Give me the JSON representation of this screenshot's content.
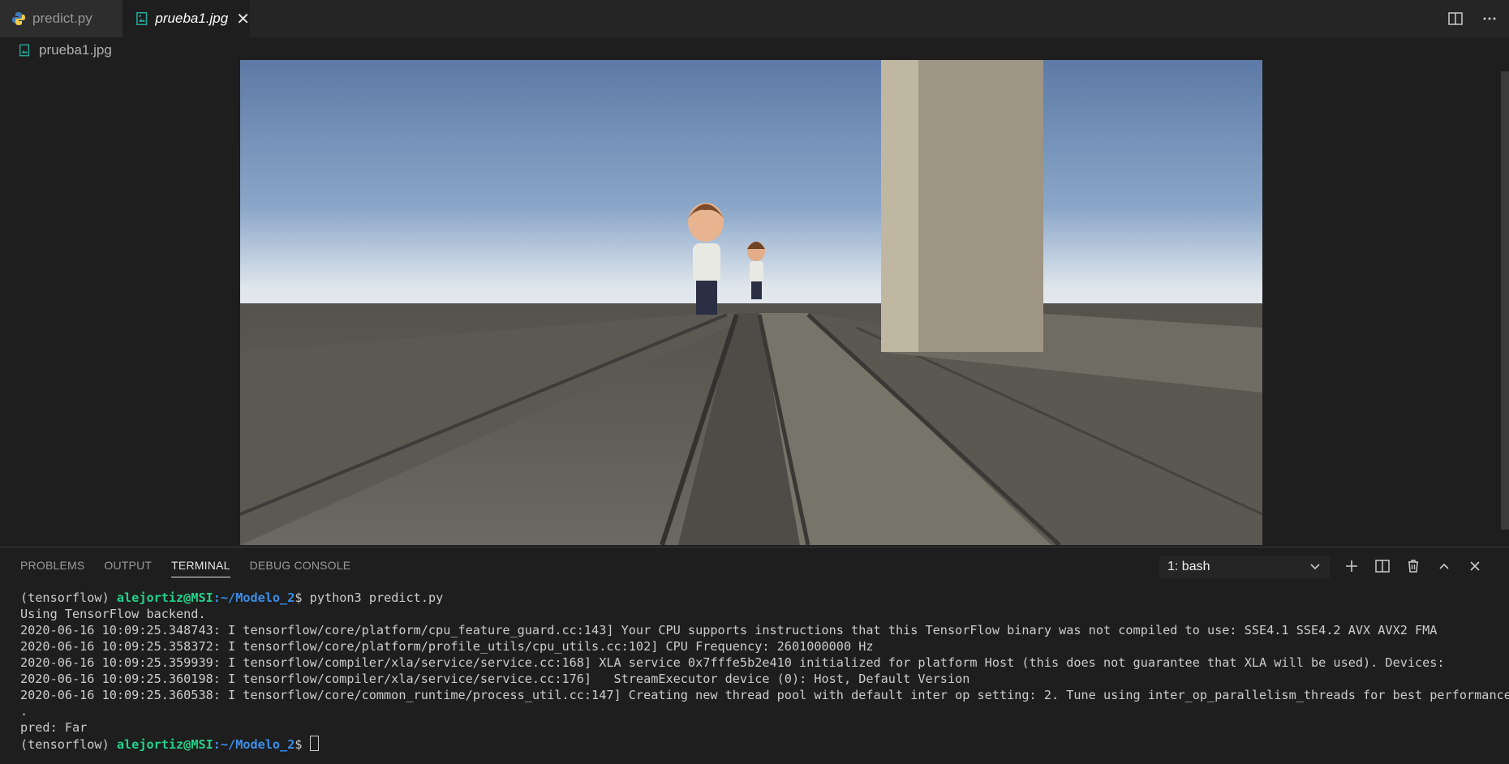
{
  "tabs": [
    {
      "label": "predict.py",
      "icon": "python-icon"
    },
    {
      "label": "prueba1.jpg",
      "icon": "image-icon"
    }
  ],
  "breadcrumb": {
    "label": "prueba1.jpg",
    "icon": "image-icon"
  },
  "panel": {
    "tabs": [
      "PROBLEMS",
      "OUTPUT",
      "TERMINAL",
      "DEBUG CONSOLE"
    ],
    "active_tab": "TERMINAL",
    "terminal_select": "1: bash"
  },
  "terminal": {
    "env": "(tensorflow)",
    "user": "alejortiz@MSI",
    "path": ":~/Modelo_2",
    "prompt_symbol": "$",
    "command": "python3 predict.py",
    "lines": [
      "Using TensorFlow backend.",
      "2020-06-16 10:09:25.348743: I tensorflow/core/platform/cpu_feature_guard.cc:143] Your CPU supports instructions that this TensorFlow binary was not compiled to use: SSE4.1 SSE4.2 AVX AVX2 FMA",
      "2020-06-16 10:09:25.358372: I tensorflow/core/platform/profile_utils/cpu_utils.cc:102] CPU Frequency: 2601000000 Hz",
      "2020-06-16 10:09:25.359939: I tensorflow/compiler/xla/service/service.cc:168] XLA service 0x7fffe5b2e410 initialized for platform Host (this does not guarantee that XLA will be used). Devices:",
      "2020-06-16 10:09:25.360198: I tensorflow/compiler/xla/service/service.cc:176]   StreamExecutor device (0): Host, Default Version",
      "2020-06-16 10:09:25.360538: I tensorflow/core/common_runtime/process_util.cc:147] Creating new thread pool with default inter op setting: 2. Tune using inter_op_parallelism_threads for best performance",
      ".",
      "pred: Far"
    ]
  },
  "colors": {
    "accent_green": "#23d18b",
    "accent_blue": "#3b8eea"
  }
}
